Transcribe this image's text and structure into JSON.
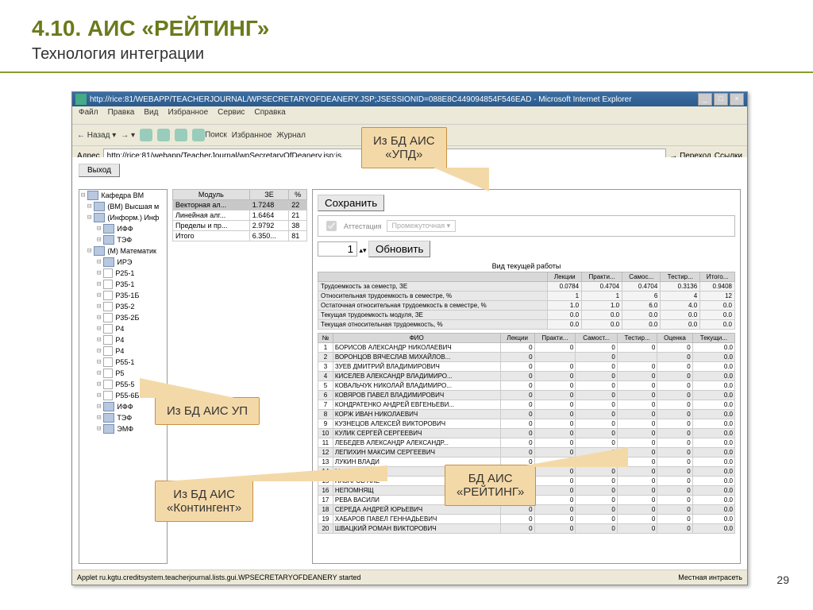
{
  "slide": {
    "title": "4.10. АИС «РЕЙТИНГ»",
    "subtitle": "Технология интеграции",
    "page": "29"
  },
  "ie": {
    "title": "http://rice:81/WEBAPP/TEACHERJOURNAL/WPSECRETARYOFDEANERY.JSP;JSESSIONID=088E8C449094854F546EAD - Microsoft Internet Explorer",
    "menu": [
      "Файл",
      "Правка",
      "Вид",
      "Избранное",
      "Сервис",
      "Справка"
    ],
    "toolbar": {
      "back": "Назад",
      "search": "Поиск",
      "fav": "Избранное",
      "journal": "Журнал"
    },
    "addr_label": "Адрес",
    "addr": "http://rice:81/webapp/TeacherJournal/wpSecretaryOfDeanery.jsp;js",
    "go": "Переход",
    "links": "Ссылки",
    "status_left": "Applet ru.kgtu.creditsystem.teacherjournal.lists.gui.WPSECRETARYOFDEANERY started",
    "status_right": "Местная интрасеть"
  },
  "app": {
    "exit": "Выход",
    "save": "Сохранить",
    "attest": "Аттестация",
    "attest_type": "Промежуточная",
    "page_val": "1",
    "update": "Обновить",
    "work_hdr": "Вид текущей работы"
  },
  "tree": [
    {
      "l": 0,
      "t": "Кафедра ВМ",
      "f": true
    },
    {
      "l": 1,
      "t": "(ВМ) Высшая м",
      "f": true
    },
    {
      "l": 1,
      "t": "(Информ.) Инф",
      "f": true
    },
    {
      "l": 2,
      "t": "ИФФ",
      "f": true
    },
    {
      "l": 2,
      "t": "ТЭФ",
      "f": true
    },
    {
      "l": 1,
      "t": "(М) Математик",
      "f": true
    },
    {
      "l": 2,
      "t": "ИРЭ",
      "f": true
    },
    {
      "l": 2,
      "t": "Р25-1"
    },
    {
      "l": 2,
      "t": "Р35-1"
    },
    {
      "l": 2,
      "t": "Р35-1Б"
    },
    {
      "l": 2,
      "t": "Р35-2"
    },
    {
      "l": 2,
      "t": "Р35-2Б"
    },
    {
      "l": 2,
      "t": "Р4"
    },
    {
      "l": 2,
      "t": "Р4"
    },
    {
      "l": 2,
      "t": "Р4"
    },
    {
      "l": 2,
      "t": "Р55-1"
    },
    {
      "l": 2,
      "t": "Р5"
    },
    {
      "l": 2,
      "t": "Р55-5"
    },
    {
      "l": 2,
      "t": "Р55-6Б"
    },
    {
      "l": 2,
      "t": "ИФФ",
      "f": true
    },
    {
      "l": 2,
      "t": "ТЭФ",
      "f": true
    },
    {
      "l": 2,
      "t": "ЭМФ",
      "f": true
    }
  ],
  "modules": {
    "cols": [
      "Модуль",
      "ЗЕ",
      "%"
    ],
    "rows": [
      [
        "Векторная ал...",
        "1.7248",
        "22"
      ],
      [
        "Линейная алг...",
        "1.6464",
        "21"
      ],
      [
        "Пределы и пр...",
        "2.9792",
        "38"
      ],
      [
        "Итого",
        "6.350...",
        "81"
      ]
    ]
  },
  "work": {
    "cols": [
      "Лекции",
      "Практи...",
      "Самос...",
      "Тестир...",
      "Итого..."
    ],
    "rows": [
      [
        "Трудоемкость за семестр, ЗЕ",
        "0.0784",
        "0.4704",
        "0.4704",
        "0.3136",
        "0.9408"
      ],
      [
        "Относительная трудоемкость в семестре, %",
        "1",
        "1",
        "6",
        "4",
        "12"
      ],
      [
        "Остаточная относительная трудоемкость в семестре, %",
        "1.0",
        "1.0",
        "6.0",
        "4.0",
        "0.0"
      ],
      [
        "Текущая трудоемкость модуля, ЗЕ",
        "0.0",
        "0.0",
        "0.0",
        "0.0",
        "0.0"
      ],
      [
        "Текущая относительная трудоемкость, %",
        "0.0",
        "0.0",
        "0.0",
        "0.0",
        "0.0"
      ]
    ]
  },
  "students": {
    "cols": [
      "№",
      "ФИО",
      "Лекции",
      "Практи...",
      "Самост...",
      "Тестир...",
      "Оценка",
      "Текущи..."
    ],
    "rows": [
      [
        1,
        "БОРИСОВ АЛЕКСАНДР НИКОЛАЕВИЧ",
        0,
        0,
        0,
        0,
        0,
        "0.0"
      ],
      [
        2,
        "ВОРОНЦОВ  ВЯЧЕСЛАВ МИХАЙЛОВ...",
        0,
        "",
        0,
        "",
        0,
        "0.0"
      ],
      [
        3,
        "ЗУЕВ ДМИТРИЙ ВЛАДИМИРОВИЧ",
        0,
        0,
        0,
        0,
        0,
        "0.0"
      ],
      [
        4,
        "КИСЕЛЕВ АЛЕКСАНДР ВЛАДИМИРО...",
        0,
        0,
        0,
        0,
        0,
        "0.0"
      ],
      [
        5,
        "КОВАЛЬЧУК НИКОЛАЙ ВЛАДИМИРО...",
        0,
        0,
        0,
        0,
        0,
        "0.0"
      ],
      [
        6,
        "КОВЯРОВ ПАВЕЛ ВЛАДИМИРОВИЧ",
        0,
        0,
        0,
        0,
        0,
        "0.0"
      ],
      [
        7,
        "КОНДРАТЕНКО АНДРЕЙ ЕВГЕНЬЕВИ...",
        0,
        0,
        0,
        0,
        0,
        "0.0"
      ],
      [
        8,
        "КОРЖ ИВАН НИКОЛАЕВИЧ",
        0,
        0,
        0,
        0,
        0,
        "0.0"
      ],
      [
        9,
        "КУЗНЕЦОВ АЛЕКСЕЙ ВИКТОРОВИЧ",
        0,
        0,
        0,
        0,
        0,
        "0.0"
      ],
      [
        10,
        "КУЛИК СЕРГЕЙ СЕРГЕЕВИЧ",
        0,
        0,
        0,
        0,
        0,
        "0.0"
      ],
      [
        11,
        "ЛЕБЕДЕВ АЛЕКСАНДР АЛЕКСАНДР...",
        0,
        0,
        0,
        0,
        0,
        "0.0"
      ],
      [
        12,
        "ЛЕПИХИН МАКСИМ СЕРГЕЕВИЧ",
        0,
        0,
        0,
        0,
        0,
        "0.0"
      ],
      [
        13,
        "ЛУКИН ВЛАДИ",
        0,
        0,
        0,
        0,
        0,
        "0.0"
      ],
      [
        14,
        "МАРТЫНОВ ЕВ",
        0,
        0,
        0,
        0,
        0,
        "0.0"
      ],
      [
        15,
        "НАЗАРОВ АЛЕ",
        0,
        0,
        0,
        0,
        0,
        "0.0"
      ],
      [
        16,
        "НЕПОМНЯЩ",
        0,
        0,
        0,
        0,
        0,
        "0.0"
      ],
      [
        17,
        "РЕВА ВАСИЛИ",
        0,
        0,
        0,
        0,
        0,
        "0.0"
      ],
      [
        18,
        "СЕРЕДА АНДРЕЙ ЮРЬЕВИЧ",
        0,
        0,
        0,
        0,
        0,
        "0.0"
      ],
      [
        19,
        "ХАБАРОВ ПАВЕЛ ГЕННАДЬЕВИЧ",
        0,
        0,
        0,
        0,
        0,
        "0.0"
      ],
      [
        20,
        "ШВАЦКИЙ РОМАН ВИКТОРОВИЧ",
        0,
        0,
        0,
        0,
        0,
        "0.0"
      ]
    ]
  },
  "callouts": {
    "c1": "Из БД АИС\n«УПД»",
    "c2": "Из БД АИС УП",
    "c3": "Из БД АИС\n«Контингент»",
    "c4": "БД АИС\n«РЕЙТИНГ»"
  }
}
